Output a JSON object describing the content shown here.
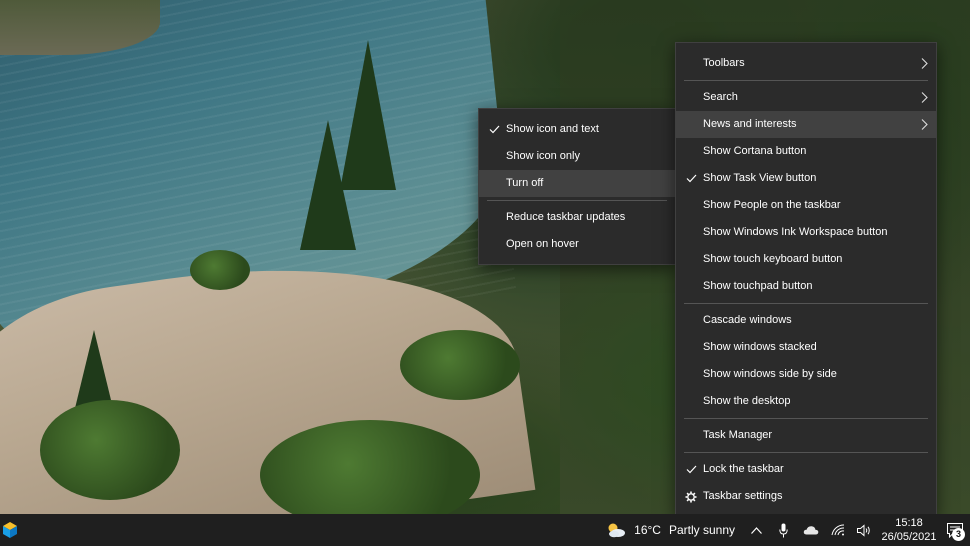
{
  "main_menu": {
    "items": [
      {
        "label": "Toolbars",
        "checked": false,
        "submenu": true
      },
      {
        "label": "Search",
        "checked": false,
        "submenu": true
      },
      {
        "label": "News and interests",
        "checked": false,
        "submenu": true,
        "highlighted": true
      },
      {
        "label": "Show Cortana button",
        "checked": false
      },
      {
        "label": "Show Task View button",
        "checked": true
      },
      {
        "label": "Show People on the taskbar",
        "checked": false
      },
      {
        "label": "Show Windows Ink Workspace button",
        "checked": false
      },
      {
        "label": "Show touch keyboard button",
        "checked": false
      },
      {
        "label": "Show touchpad button",
        "checked": false
      },
      {
        "label": "Cascade windows",
        "checked": false
      },
      {
        "label": "Show windows stacked",
        "checked": false
      },
      {
        "label": "Show windows side by side",
        "checked": false
      },
      {
        "label": "Show the desktop",
        "checked": false
      },
      {
        "label": "Task Manager",
        "checked": false
      },
      {
        "label": "Lock the taskbar",
        "checked": true
      },
      {
        "label": "Taskbar settings",
        "icon": "gear-icon"
      }
    ]
  },
  "sub_menu": {
    "items": [
      {
        "label": "Show icon and text",
        "checked": true
      },
      {
        "label": "Show icon only",
        "checked": false
      },
      {
        "label": "Turn off",
        "checked": false,
        "highlighted": true
      },
      {
        "label": "Reduce taskbar updates",
        "checked": false
      },
      {
        "label": "Open on hover",
        "checked": false
      }
    ]
  },
  "taskbar": {
    "weather": {
      "temperature": "16°C",
      "condition": "Partly sunny",
      "icon": "partly-sunny-icon"
    },
    "tray_icons": [
      "chevron-up-icon",
      "microphone-icon",
      "onedrive-cloud-icon",
      "wifi-icon",
      "volume-icon"
    ],
    "clock": {
      "time": "15:18",
      "date": "26/05/2021"
    },
    "notifications": {
      "count": "3"
    }
  },
  "colors": {
    "menu_bg": "#2b2b2b",
    "menu_highlight": "#414141",
    "taskbar_bg": "#1f1f1f"
  }
}
